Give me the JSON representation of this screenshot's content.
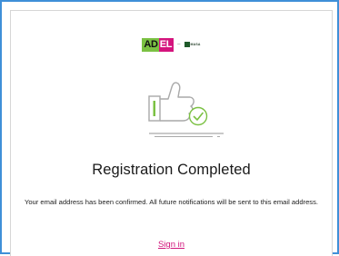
{
  "brand": {
    "logo_ad": "AD",
    "logo_el": "EL",
    "partner_name": "MASA",
    "colors": {
      "green": "#7bc143",
      "magenta": "#d4147d",
      "frame_blue": "#3f8fd8"
    }
  },
  "illustration": {
    "icon": "thumbs-up-check-icon"
  },
  "content": {
    "title": "Registration Completed",
    "message": "Your email address has been confirmed. All future notifications will be sent to this email address.",
    "signin_label": "Sign in"
  }
}
